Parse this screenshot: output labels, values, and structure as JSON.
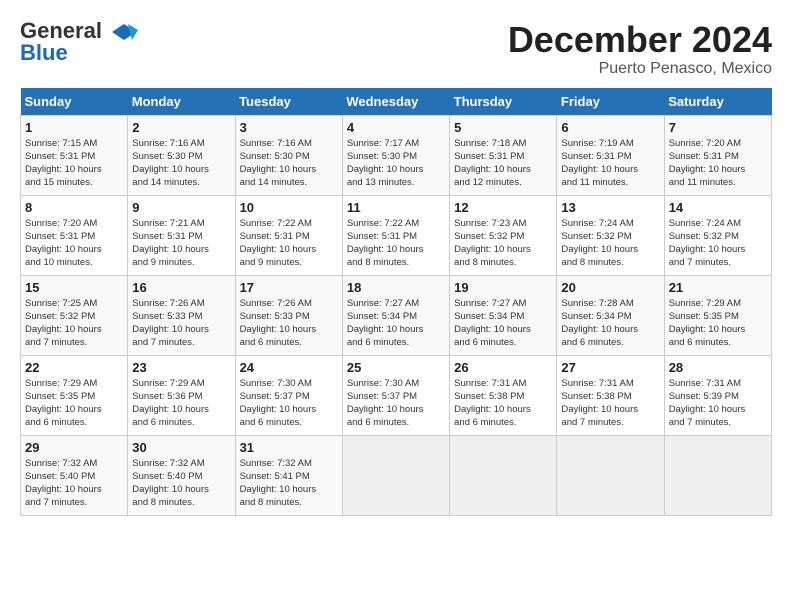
{
  "header": {
    "logo_line1": "General",
    "logo_line2": "Blue",
    "month": "December 2024",
    "location": "Puerto Penasco, Mexico"
  },
  "weekdays": [
    "Sunday",
    "Monday",
    "Tuesday",
    "Wednesday",
    "Thursday",
    "Friday",
    "Saturday"
  ],
  "weeks": [
    [
      {
        "day": "1",
        "info": "Sunrise: 7:15 AM\nSunset: 5:31 PM\nDaylight: 10 hours\nand 15 minutes."
      },
      {
        "day": "2",
        "info": "Sunrise: 7:16 AM\nSunset: 5:30 PM\nDaylight: 10 hours\nand 14 minutes."
      },
      {
        "day": "3",
        "info": "Sunrise: 7:16 AM\nSunset: 5:30 PM\nDaylight: 10 hours\nand 14 minutes."
      },
      {
        "day": "4",
        "info": "Sunrise: 7:17 AM\nSunset: 5:30 PM\nDaylight: 10 hours\nand 13 minutes."
      },
      {
        "day": "5",
        "info": "Sunrise: 7:18 AM\nSunset: 5:31 PM\nDaylight: 10 hours\nand 12 minutes."
      },
      {
        "day": "6",
        "info": "Sunrise: 7:19 AM\nSunset: 5:31 PM\nDaylight: 10 hours\nand 11 minutes."
      },
      {
        "day": "7",
        "info": "Sunrise: 7:20 AM\nSunset: 5:31 PM\nDaylight: 10 hours\nand 11 minutes."
      }
    ],
    [
      {
        "day": "8",
        "info": "Sunrise: 7:20 AM\nSunset: 5:31 PM\nDaylight: 10 hours\nand 10 minutes."
      },
      {
        "day": "9",
        "info": "Sunrise: 7:21 AM\nSunset: 5:31 PM\nDaylight: 10 hours\nand 9 minutes."
      },
      {
        "day": "10",
        "info": "Sunrise: 7:22 AM\nSunset: 5:31 PM\nDaylight: 10 hours\nand 9 minutes."
      },
      {
        "day": "11",
        "info": "Sunrise: 7:22 AM\nSunset: 5:31 PM\nDaylight: 10 hours\nand 8 minutes."
      },
      {
        "day": "12",
        "info": "Sunrise: 7:23 AM\nSunset: 5:32 PM\nDaylight: 10 hours\nand 8 minutes."
      },
      {
        "day": "13",
        "info": "Sunrise: 7:24 AM\nSunset: 5:32 PM\nDaylight: 10 hours\nand 8 minutes."
      },
      {
        "day": "14",
        "info": "Sunrise: 7:24 AM\nSunset: 5:32 PM\nDaylight: 10 hours\nand 7 minutes."
      }
    ],
    [
      {
        "day": "15",
        "info": "Sunrise: 7:25 AM\nSunset: 5:32 PM\nDaylight: 10 hours\nand 7 minutes."
      },
      {
        "day": "16",
        "info": "Sunrise: 7:26 AM\nSunset: 5:33 PM\nDaylight: 10 hours\nand 7 minutes."
      },
      {
        "day": "17",
        "info": "Sunrise: 7:26 AM\nSunset: 5:33 PM\nDaylight: 10 hours\nand 6 minutes."
      },
      {
        "day": "18",
        "info": "Sunrise: 7:27 AM\nSunset: 5:34 PM\nDaylight: 10 hours\nand 6 minutes."
      },
      {
        "day": "19",
        "info": "Sunrise: 7:27 AM\nSunset: 5:34 PM\nDaylight: 10 hours\nand 6 minutes."
      },
      {
        "day": "20",
        "info": "Sunrise: 7:28 AM\nSunset: 5:34 PM\nDaylight: 10 hours\nand 6 minutes."
      },
      {
        "day": "21",
        "info": "Sunrise: 7:29 AM\nSunset: 5:35 PM\nDaylight: 10 hours\nand 6 minutes."
      }
    ],
    [
      {
        "day": "22",
        "info": "Sunrise: 7:29 AM\nSunset: 5:35 PM\nDaylight: 10 hours\nand 6 minutes."
      },
      {
        "day": "23",
        "info": "Sunrise: 7:29 AM\nSunset: 5:36 PM\nDaylight: 10 hours\nand 6 minutes."
      },
      {
        "day": "24",
        "info": "Sunrise: 7:30 AM\nSunset: 5:37 PM\nDaylight: 10 hours\nand 6 minutes."
      },
      {
        "day": "25",
        "info": "Sunrise: 7:30 AM\nSunset: 5:37 PM\nDaylight: 10 hours\nand 6 minutes."
      },
      {
        "day": "26",
        "info": "Sunrise: 7:31 AM\nSunset: 5:38 PM\nDaylight: 10 hours\nand 6 minutes."
      },
      {
        "day": "27",
        "info": "Sunrise: 7:31 AM\nSunset: 5:38 PM\nDaylight: 10 hours\nand 7 minutes."
      },
      {
        "day": "28",
        "info": "Sunrise: 7:31 AM\nSunset: 5:39 PM\nDaylight: 10 hours\nand 7 minutes."
      }
    ],
    [
      {
        "day": "29",
        "info": "Sunrise: 7:32 AM\nSunset: 5:40 PM\nDaylight: 10 hours\nand 7 minutes."
      },
      {
        "day": "30",
        "info": "Sunrise: 7:32 AM\nSunset: 5:40 PM\nDaylight: 10 hours\nand 8 minutes."
      },
      {
        "day": "31",
        "info": "Sunrise: 7:32 AM\nSunset: 5:41 PM\nDaylight: 10 hours\nand 8 minutes."
      },
      {
        "day": "",
        "info": ""
      },
      {
        "day": "",
        "info": ""
      },
      {
        "day": "",
        "info": ""
      },
      {
        "day": "",
        "info": ""
      }
    ]
  ]
}
